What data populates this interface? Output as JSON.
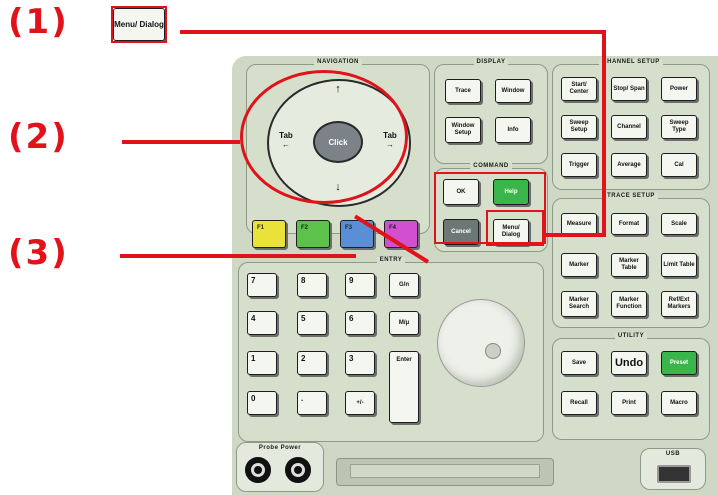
{
  "callouts": [
    "(1)",
    "(2)",
    "(3)"
  ],
  "menu_dialog_key": "Menu/ Dialog",
  "groups": {
    "navigation": "NAVIGATION",
    "display": "DISPLAY",
    "channel_setup": "CHANNEL SETUP",
    "command": "COMMAND",
    "trace_setup": "TRACE SETUP",
    "entry": "ENTRY",
    "utility": "UTILITY",
    "probe_power": "Probe Power",
    "usb": "USB"
  },
  "navigation": {
    "up": "↑",
    "down": "↓",
    "left": "Tab ←",
    "right": "Tab →",
    "center": "Click"
  },
  "display_keys": [
    "Trace",
    "Window",
    "Window Setup",
    "Info"
  ],
  "channel_keys": [
    "Start/ Center",
    "Stop/ Span",
    "Power",
    "Sweep Setup",
    "Channel",
    "Sweep Type",
    "Trigger",
    "Average",
    "Cal"
  ],
  "command_keys": {
    "ok": "OK",
    "help": "Help",
    "cancel": "Cancel",
    "menu_dialog": "Menu/ Dialog"
  },
  "function_keys": [
    "F1",
    "F2",
    "F3",
    "F4"
  ],
  "trace_keys": [
    "Measure",
    "Format",
    "Scale",
    "Marker",
    "Marker Table",
    "Limit Table",
    "Marker Search",
    "Marker Function",
    "Ref/Ext Markers"
  ],
  "entry_keys": {
    "row1": [
      "7",
      "8",
      "9",
      "G/n"
    ],
    "row2": [
      "4",
      "5",
      "6",
      "M/μ"
    ],
    "row3": [
      "1",
      "2",
      "3",
      "Enter"
    ],
    "row4": [
      "0",
      ".",
      "+/-"
    ]
  },
  "utility_keys": [
    "Save",
    "Recall",
    "Preset",
    "Undo",
    "Print",
    "Macro"
  ],
  "colors": {
    "red": "#e0121a",
    "f1": "#e8e23a",
    "f2": "#5cc24a",
    "f3": "#5a8fd6",
    "f4": "#d24fd0",
    "green_key": "#39b54a",
    "cancel_key": "#6d7775",
    "panel": "#cfd8c4"
  }
}
